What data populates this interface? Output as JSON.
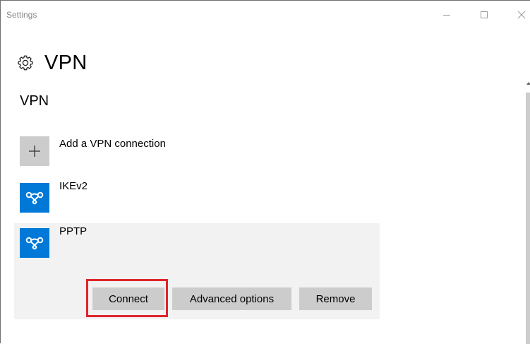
{
  "window": {
    "app_title": "Settings"
  },
  "page": {
    "title": "VPN",
    "icon": "gear-icon"
  },
  "section": {
    "title": "VPN"
  },
  "add_connection": {
    "label": "Add a VPN connection",
    "icon": "plus-icon"
  },
  "connections": [
    {
      "name": "IKEv2",
      "icon": "vpn-icon"
    },
    {
      "name": "PPTP",
      "icon": "vpn-icon"
    }
  ],
  "selected_connection": {
    "name": "PPTP",
    "buttons": {
      "connect": "Connect",
      "advanced": "Advanced options",
      "remove": "Remove"
    }
  },
  "colors": {
    "accent": "#0078d7",
    "tile_gray": "#cccccc",
    "button_gray": "#cccccc",
    "selected_bg": "#f2f2f2",
    "highlight": "#e0242b"
  }
}
